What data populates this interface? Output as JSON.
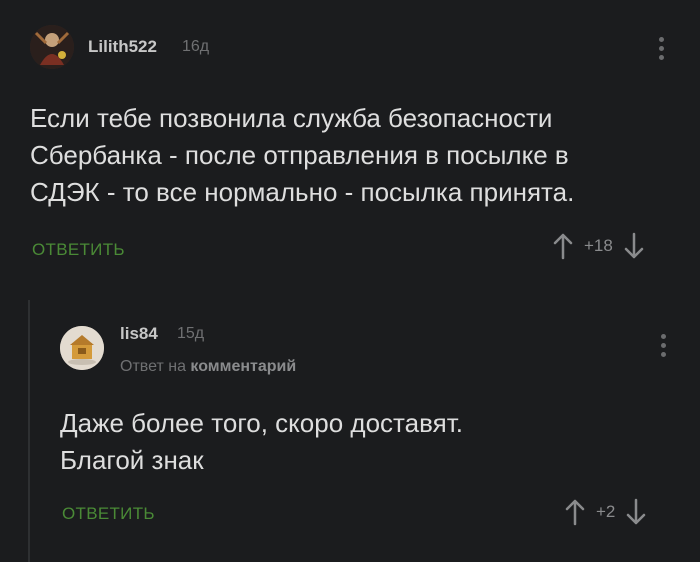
{
  "comments": [
    {
      "username": "Lilith522",
      "time": "16д",
      "text": "Если тебе позвонила служба безопасности\nСбербанка - после отправления в посылке в\nСДЭК - то все нормально - посылка принята.",
      "reply_label": "ОТВЕТИТЬ",
      "rating": "+18",
      "avatar_icon": "user-avatar-icon"
    },
    {
      "username": "lis84",
      "time": "15д",
      "reply_to_prefix": "Ответ на",
      "reply_to_link": "комментарий",
      "text": "Даже более того, скоро доставят.\nБлагой знак",
      "reply_label": "ОТВЕТИТЬ",
      "rating": "+2",
      "avatar_icon": "user-avatar-icon"
    }
  ],
  "colors": {
    "background": "#1b1c1e",
    "accent_green": "#4a8a36",
    "muted": "#6f7072"
  }
}
